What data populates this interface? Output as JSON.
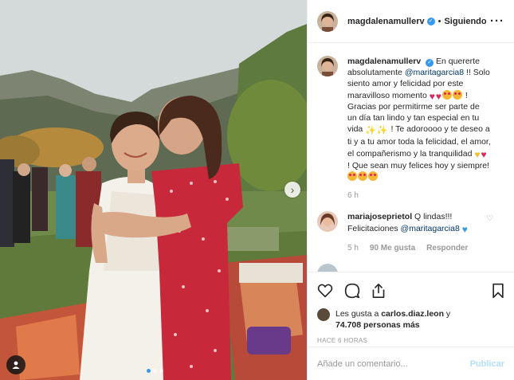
{
  "header": {
    "username": "magdalenamullerv",
    "separator": "•",
    "follow_status": "Siguiendo",
    "more_icon": "more-horizontal-icon"
  },
  "caption": {
    "username": "magdalenamullerv",
    "text_1": "En quererte absolutamente",
    "mention_1": "@maritagarcia8",
    "text_2": "!! Solo siento amor y felicidad por este maravilloso momento",
    "text_3": "! Gracias por permitirme ser parte de un día tan lindo y tan especial en tu vida",
    "text_4": "! Te adoroooo y te deseo a ti y a tu amor toda la felicidad, el amor, el compañerismo y la tranquilidad",
    "text_5": "! Que sean muy felices hoy y siempre!",
    "time": "6 h"
  },
  "comment": {
    "username": "mariajoseprietol",
    "text_1": "Q lindas!!! Felicitaciones",
    "mention": "@maritagarcia8",
    "time": "5 h",
    "likes": "90 Me gusta",
    "reply": "Responder"
  },
  "likes": {
    "prefix": "Les gusta a",
    "user": "carlos.diaz.leon",
    "joiner": "y",
    "count": "74.708 personas más"
  },
  "timestamp": "HACE 6 HORAS",
  "add_comment": {
    "placeholder": "Añade un comentario...",
    "post_label": "Publicar"
  },
  "carousel": {
    "total": 3,
    "active_index": 0
  },
  "colors": {
    "link": "#003569",
    "verified": "#3897f0",
    "post_button_disabled": "#b2dffc",
    "muted": "#999999"
  }
}
